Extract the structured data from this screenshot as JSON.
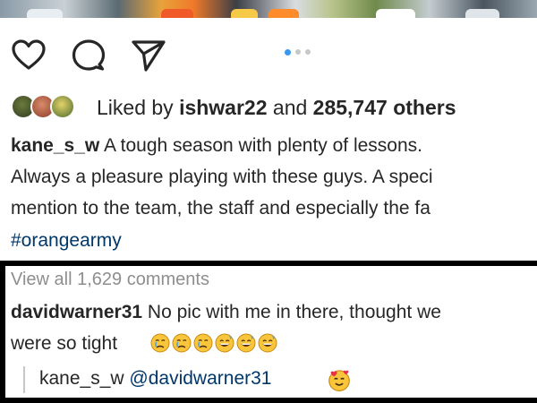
{
  "post": {
    "liked_prefix": "Liked by",
    "liked_user": "ishwar22",
    "liked_and": "and",
    "liked_count": "285,747 others",
    "caption": {
      "username": "kane_s_w",
      "line1": "A tough season with plenty of lessons.",
      "line2": "Always a pleasure playing with these guys. A speci",
      "line3": "mention to the team, the staff and especially the fa",
      "hashtag": "#orangearmy"
    },
    "carousel": {
      "count": 3,
      "active_index": 0
    }
  },
  "comments": {
    "view_all": "View all 1,629 comments",
    "first": {
      "username": "davidwarner31",
      "text_line1": "No pic with me in there, thought we",
      "text_line2": "were so tight",
      "emojis": [
        "crying-face",
        "crying-face",
        "crying-face",
        "grinning-sweat-face",
        "grinning-sweat-face",
        "grinning-sweat-face"
      ]
    },
    "reply": {
      "username": "kane_s_w",
      "text": "@davidwarner31",
      "emoji": "smiling-face-with-hearts"
    }
  },
  "icons": [
    "heart-icon",
    "comment-icon",
    "share-icon"
  ],
  "colors": {
    "accent_blue": "#3897f0",
    "hashtag": "#00376b",
    "muted": "#8e8e8e",
    "text": "#262626"
  }
}
